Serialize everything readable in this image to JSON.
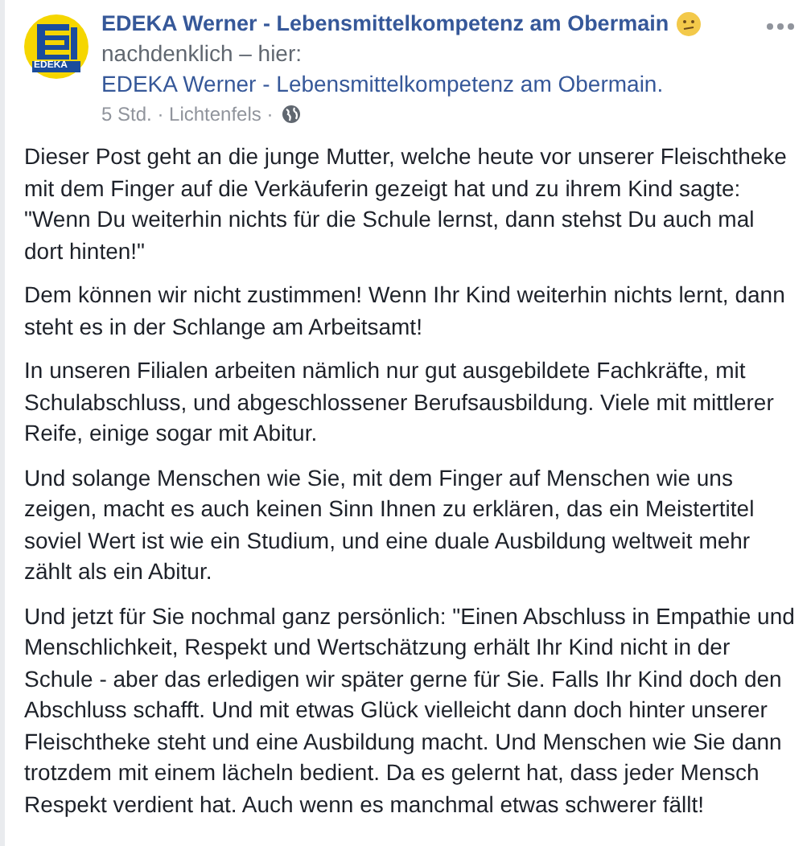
{
  "post": {
    "logo_text": "EDEKA",
    "page_name": "EDEKA Werner - Lebensmittelkompetenz am Obermain",
    "feeling": "nachdenklich – hier: ",
    "location_link": "EDEKA Werner - Lebensmittelkompetenz am Obermain.",
    "time": "5 Std.",
    "separator_1": " · ",
    "place": "Lichtenfels",
    "separator_2": " · ",
    "paragraphs": [
      "Dieser Post geht an die junge Mutter, welche heute vor unserer Fleischtheke mit dem Finger auf die Verkäuferin gezeigt hat und zu ihrem Kind sagte: \"Wenn Du weiterhin nichts für die Schule lernst, dann stehst Du auch mal dort hinten!\"",
      "Dem können wir nicht zustimmen! Wenn Ihr Kind weiterhin nichts lernt, dann steht es in der Schlange am Arbeitsamt!",
      "In unseren Filialen arbeiten nämlich nur gut ausgebildete Fachkräfte, mit Schulabschluss, und abgeschlossener Berufsausbildung. Viele mit mittlerer Reife, einige sogar mit Abitur.",
      "Und solange Menschen wie Sie, mit dem Finger auf Menschen wie uns zeigen, macht es auch keinen Sinn Ihnen zu erklären, das ein Meistertitel soviel Wert ist wie ein Studium, und eine duale Ausbildung weltweit mehr zählt als ein Abitur.",
      "Und jetzt für Sie nochmal ganz persönlich: \"Einen Abschluss in Empathie und Menschlichkeit, Respekt und Wertschätzung erhält Ihr Kind nicht in der Schule - aber das erledigen wir später gerne für Sie. Falls Ihr Kind doch den Abschluss schafft. Und mit etwas Glück vielleicht dann doch hinter unserer Fleischtheke steht und eine Ausbildung macht. Und Menschen wie Sie dann trotzdem mit einem lächeln bedient. Da es gelernt hat, dass jeder Mensch Respekt verdient hat. Auch wenn es manchmal etwas schwerer fällt!"
    ]
  }
}
